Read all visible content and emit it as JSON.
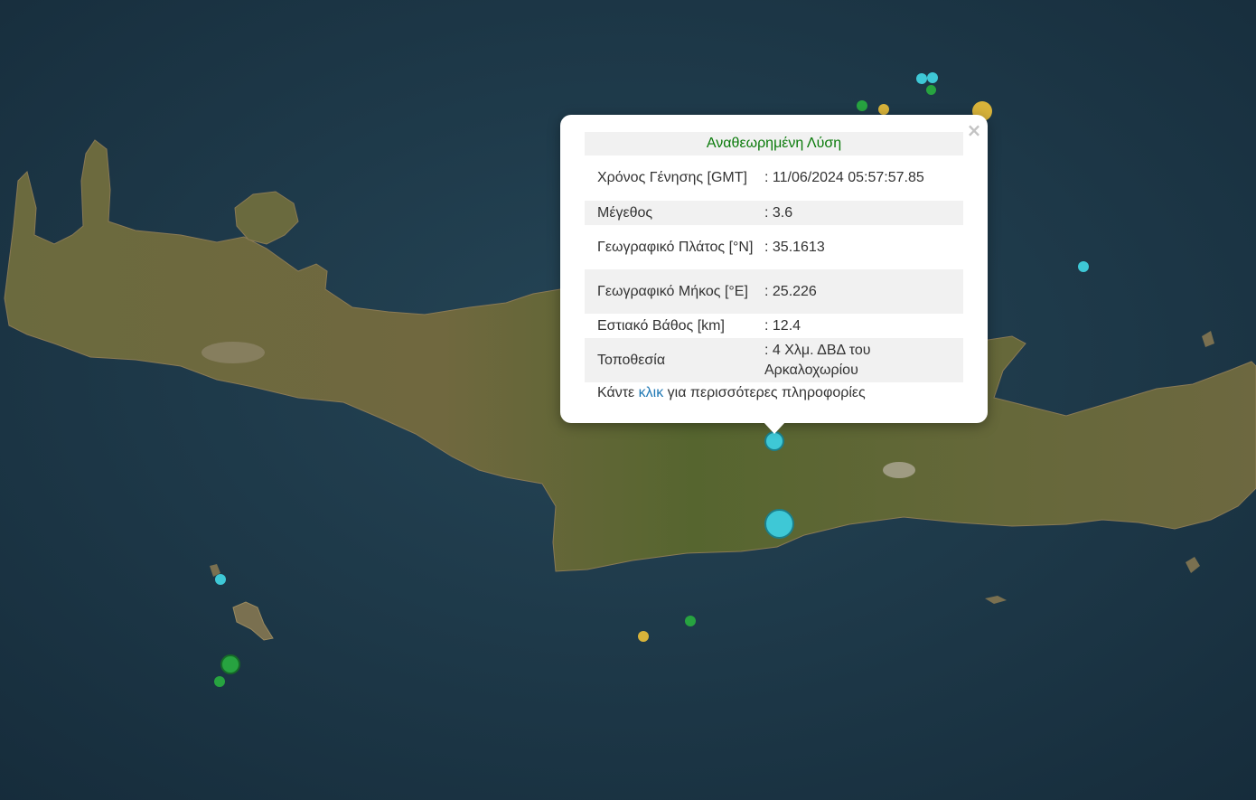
{
  "popup": {
    "header": "Αναθεωρημένη Λύση",
    "close_glyph": "×",
    "rows": [
      {
        "label": "Χρόνος Γένησης [GMT]",
        "value": ": 11/06/2024 05:57:57.85"
      },
      {
        "label": "Μέγεθος",
        "value": ": 3.6"
      },
      {
        "label": "Γεωγραφικό Πλάτος [°N]",
        "value": ": 35.1613"
      },
      {
        "label": "Γεωγραφικό Μήκος [°E]",
        "value": ": 25.226"
      },
      {
        "label": "Εστιακό Βάθος [km]",
        "value": ": 12.4"
      },
      {
        "label": "Τοποθεσία",
        "value": ": 4 Χλμ. ΔΒΔ του Αρκαλοχωρίου"
      }
    ],
    "more_prefix": "Κάντε",
    "more_link": "κλικ",
    "more_suffix": "για περισσότερες πληροφορίες"
  },
  "colors": {
    "sea": "#1f3a4c",
    "land": "#6a6a3c",
    "marker_cyan": "#3ec8d6",
    "marker_green": "#27a340",
    "marker_yellow": "#d8b33a"
  }
}
